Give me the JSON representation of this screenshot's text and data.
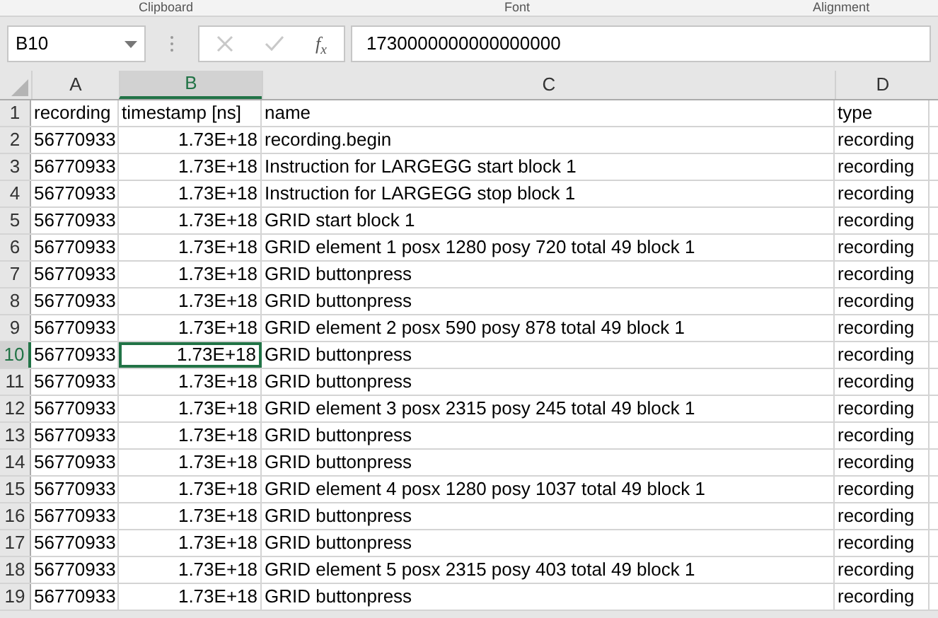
{
  "ribbon_groups": [
    "Clipboard",
    "Font",
    "Alignment"
  ],
  "name_box": "B10",
  "function_button": "f$_{x}$",
  "formula": "1730000000000000000",
  "columns": [
    {
      "label": "A",
      "selected": false
    },
    {
      "label": "B",
      "selected": true
    },
    {
      "label": "C",
      "selected": false
    },
    {
      "label": "D",
      "selected": false
    }
  ],
  "rows": [
    {
      "number": "1",
      "selected": false,
      "cells": [
        "recording",
        "timestamp [ns]",
        "name",
        "type"
      ]
    },
    {
      "number": "2",
      "selected": false,
      "cells": [
        "56770933",
        "1.73E+18",
        "recording.begin",
        "recording"
      ]
    },
    {
      "number": "3",
      "selected": false,
      "cells": [
        "56770933",
        "1.73E+18",
        "Instruction for LARGEGG start block 1",
        "recording"
      ]
    },
    {
      "number": "4",
      "selected": false,
      "cells": [
        "56770933",
        "1.73E+18",
        "Instruction for LARGEGG stop block 1",
        "recording"
      ]
    },
    {
      "number": "5",
      "selected": false,
      "cells": [
        "56770933",
        "1.73E+18",
        "GRID start block 1",
        "recording"
      ]
    },
    {
      "number": "6",
      "selected": false,
      "cells": [
        "56770933",
        "1.73E+18",
        "GRID element 1 posx 1280 posy 720 total 49 block 1",
        "recording"
      ]
    },
    {
      "number": "7",
      "selected": false,
      "cells": [
        "56770933",
        "1.73E+18",
        "GRID buttonpress",
        "recording"
      ]
    },
    {
      "number": "8",
      "selected": false,
      "cells": [
        "56770933",
        "1.73E+18",
        "GRID buttonpress",
        "recording"
      ]
    },
    {
      "number": "9",
      "selected": false,
      "cells": [
        "56770933",
        "1.73E+18",
        "GRID element 2 posx 590 posy 878 total 49 block 1",
        "recording"
      ]
    },
    {
      "number": "10",
      "selected": true,
      "cells": [
        "56770933",
        "1.73E+18",
        "GRID buttonpress",
        "recording"
      ]
    },
    {
      "number": "11",
      "selected": false,
      "cells": [
        "56770933",
        "1.73E+18",
        "GRID buttonpress",
        "recording"
      ]
    },
    {
      "number": "12",
      "selected": false,
      "cells": [
        "56770933",
        "1.73E+18",
        "GRID element 3 posx 2315 posy 245 total 49 block 1",
        "recording"
      ]
    },
    {
      "number": "13",
      "selected": false,
      "cells": [
        "56770933",
        "1.73E+18",
        "GRID buttonpress",
        "recording"
      ]
    },
    {
      "number": "14",
      "selected": false,
      "cells": [
        "56770933",
        "1.73E+18",
        "GRID buttonpress",
        "recording"
      ]
    },
    {
      "number": "15",
      "selected": false,
      "cells": [
        "56770933",
        "1.73E+18",
        "GRID element 4 posx 1280 posy 1037 total 49 block 1",
        "recording"
      ]
    },
    {
      "number": "16",
      "selected": false,
      "cells": [
        "56770933",
        "1.73E+18",
        "GRID buttonpress",
        "recording"
      ]
    },
    {
      "number": "17",
      "selected": false,
      "cells": [
        "56770933",
        "1.73E+18",
        "GRID buttonpress",
        "recording"
      ]
    },
    {
      "number": "18",
      "selected": false,
      "cells": [
        "56770933",
        "1.73E+18",
        "GRID element 5 posx 2315 posy 403 total 49 block 1",
        "recording"
      ]
    },
    {
      "number": "19",
      "selected": false,
      "cells": [
        "56770933",
        "1.73E+18",
        "GRID buttonpress",
        "recording"
      ]
    }
  ]
}
